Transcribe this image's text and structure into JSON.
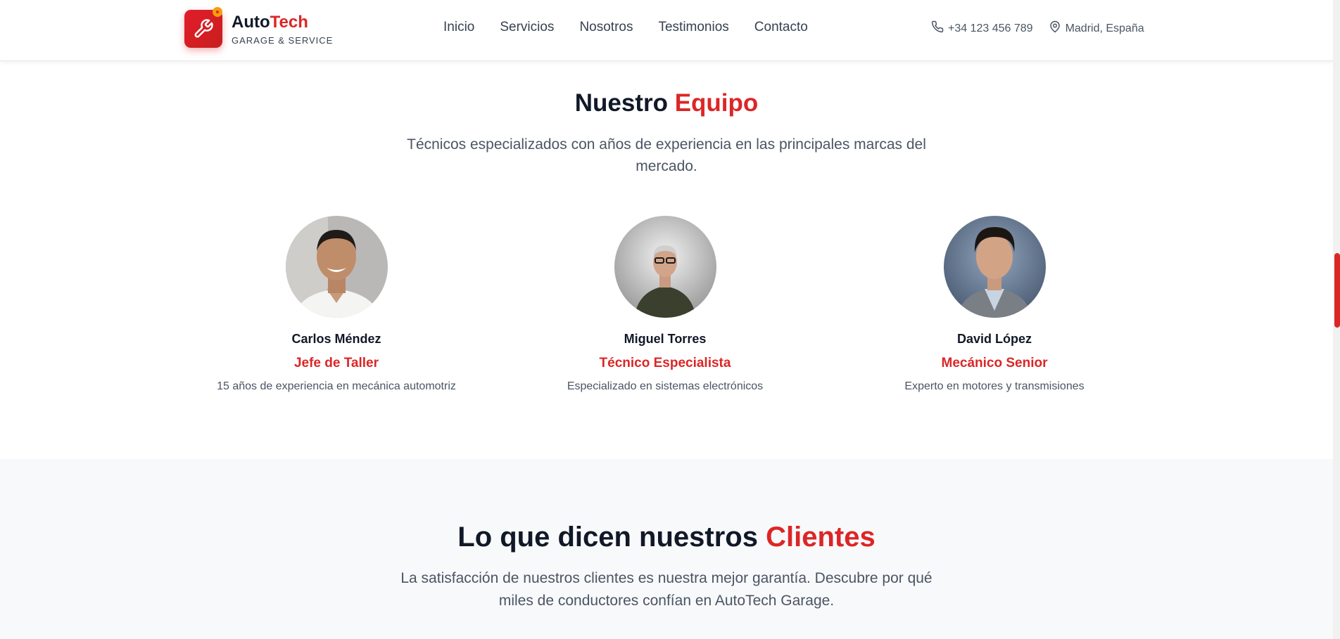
{
  "header": {
    "brand_part1": "Auto",
    "brand_part2": "Tech",
    "brand_sub": "GARAGE & SERVICE",
    "nav": [
      "Inicio",
      "Servicios",
      "Nosotros",
      "Testimonios",
      "Contacto"
    ],
    "phone": "+34 123 456 789",
    "location": "Madrid, España"
  },
  "team": {
    "title_part1": "Nuestro",
    "title_part2": "Equipo",
    "subtitle": "Técnicos especializados con años de experiencia en las principales marcas del mercado.",
    "members": [
      {
        "name": "Carlos Méndez",
        "role": "Jefe de Taller",
        "desc": "15 años de experiencia en mecánica automotriz"
      },
      {
        "name": "Miguel Torres",
        "role": "Técnico Especialista",
        "desc": "Especializado en sistemas electrónicos"
      },
      {
        "name": "David López",
        "role": "Mecánico Senior",
        "desc": "Experto en motores y transmisiones"
      }
    ]
  },
  "testimonials": {
    "title_part1": "Lo que dicen nuestros",
    "title_part2": "Clientes",
    "subtitle": "La satisfacción de nuestros clientes es nuestra mejor garantía. Descubre por qué miles de conductores confían en AutoTech Garage."
  },
  "colors": {
    "accent": "#dc2626",
    "text": "#111827",
    "muted": "#4b5563"
  }
}
